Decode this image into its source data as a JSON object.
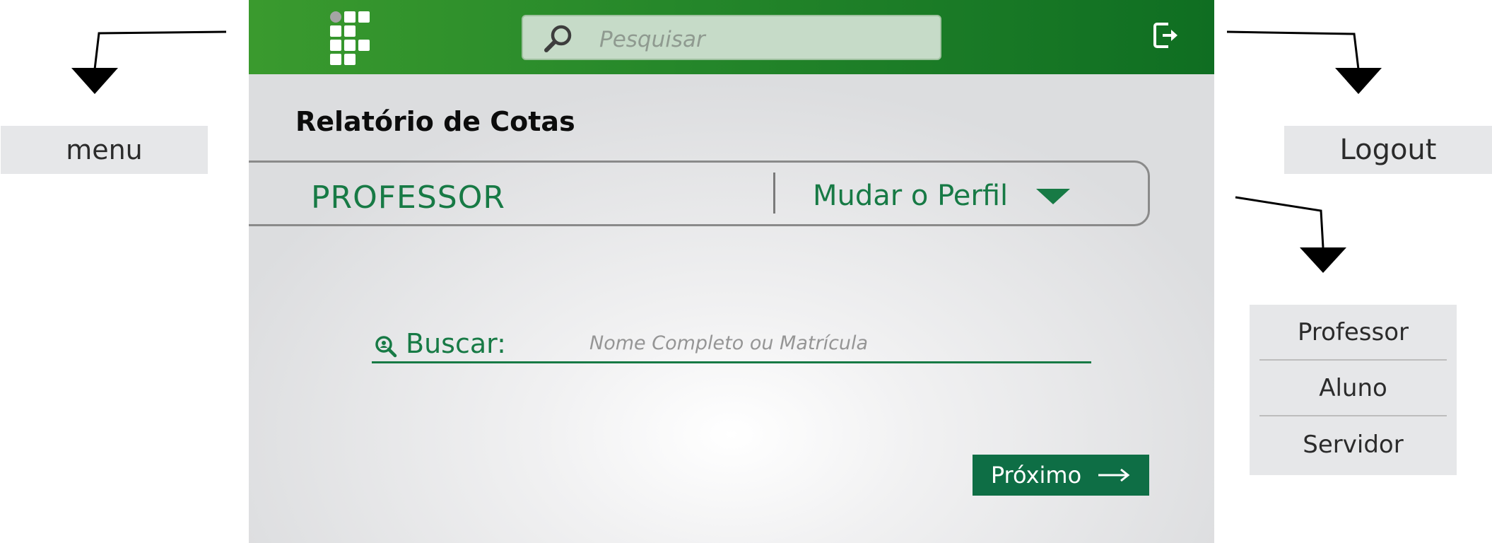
{
  "header": {
    "logo": "institution-logo",
    "search_placeholder": "Pesquisar",
    "logout_icon": "logout-icon"
  },
  "page": {
    "title": "Relatório de Cotas"
  },
  "profile": {
    "current": "PROFESSOR",
    "change_label": "Mudar o Perfil"
  },
  "search_form": {
    "label": "Buscar:",
    "placeholder": "Nome Completo ou Matrícula"
  },
  "next_button": {
    "label": "Próximo"
  },
  "annotations": {
    "menu_label": "menu",
    "logout_label": "Logout",
    "profile_options": [
      "Professor",
      "Aluno",
      "Servidor"
    ]
  },
  "colors": {
    "header_green_start": "#3a9a2e",
    "header_green_end": "#0f6e22",
    "accent_green": "#177a45",
    "button_green": "#0e6e45"
  }
}
